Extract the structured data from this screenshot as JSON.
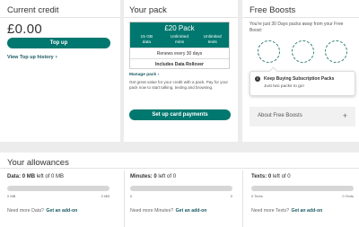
{
  "credit": {
    "title": "Current credit",
    "balance": "£0.00",
    "topup_label": "Top up",
    "history_label": "View Top up history",
    "history_chevron": "›"
  },
  "pack": {
    "title": "Your pack",
    "name": "£20 Pack",
    "features": [
      {
        "value": "15 GB",
        "unit": "data"
      },
      {
        "value": "Unlimited",
        "unit": "mins"
      },
      {
        "value": "Unlimited",
        "unit": "texts"
      }
    ],
    "renew_text": "Renews every 30 days",
    "rollover_text": "Includes Data Rollover",
    "manage_label": "Manage pack",
    "manage_chevron": "›",
    "description": "Get great value for your credit with a pack. Pay for your pack now to start talking, texting and browsing.",
    "card_button_label": "Set up card payments"
  },
  "boosts": {
    "title": "Free Boosts",
    "description": "You're just 30 Days packs away from your Free Boost:",
    "popup_icon": "i",
    "popup_title": "Keep Buying Subscription Packs",
    "popup_sub": "Just two packs to go!",
    "about_label": "About Free Boosts",
    "about_icon": "+"
  },
  "allowances": {
    "title": "Your allowances",
    "items": [
      {
        "label": "Data:",
        "amount": "0 MB",
        "left_of": "left of 0 MB",
        "min": "0 MB",
        "max": "0 MB",
        "more": "Need more Data?",
        "addon": "Get an add-on",
        "fill": 0
      },
      {
        "label": "Minutes:",
        "amount": "0",
        "left_of": "left of 0",
        "min": "0",
        "max": "0",
        "more": "Need more Minutes?",
        "addon": "Get an add-on",
        "fill": 0
      },
      {
        "label": "Texts:",
        "amount": "0",
        "left_of": "left of 0",
        "min": "0 Texts",
        "max": "0 Texts",
        "more": "Need more Texts?",
        "addon": "Get an add-on",
        "fill": 0
      }
    ]
  },
  "colors": {
    "accent": "#00786f",
    "link": "#1b5b63"
  }
}
